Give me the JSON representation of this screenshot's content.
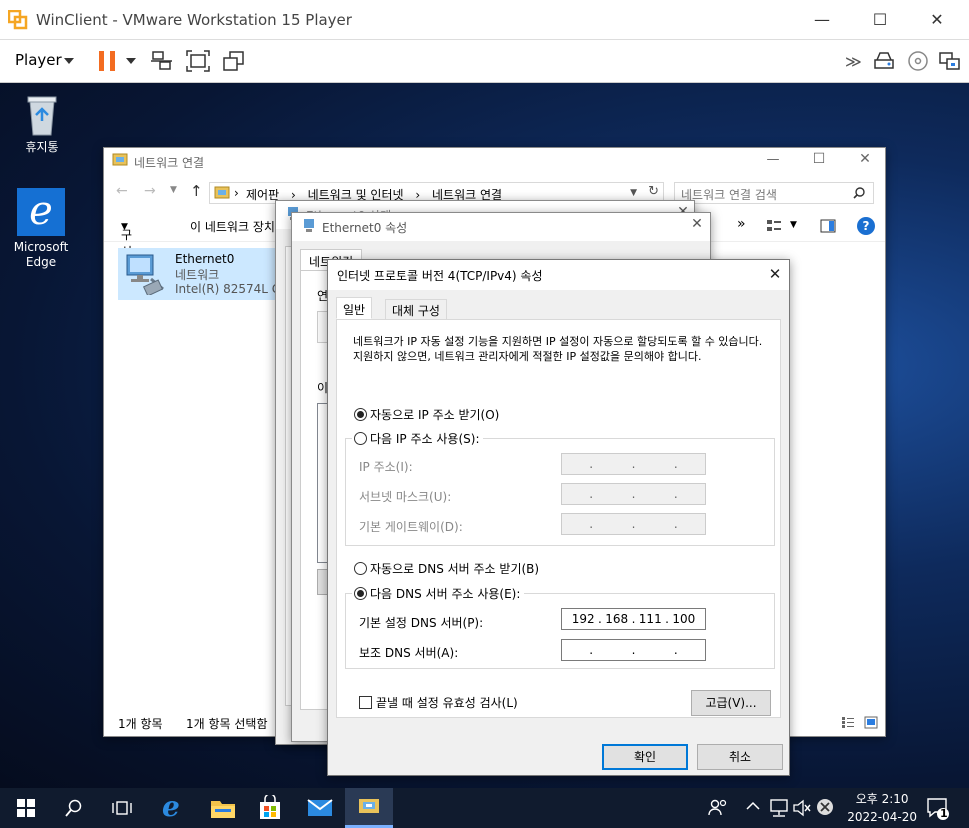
{
  "vm": {
    "title": "WinClient - VMware Workstation 15 Player",
    "player_label": "Player",
    "colors": {
      "pause": "#f36c21",
      "vmware_logo": "#f5a623"
    }
  },
  "desktop": {
    "recycle_bin_label": "휴지통",
    "edge_label_1": "Microsoft",
    "edge_label_2": "Edge"
  },
  "netwin": {
    "title": "네트워크 연결",
    "breadcrumb": {
      "sep": "›",
      "items": [
        "제어판",
        "네트워크 및 인터넷",
        "네트워크 연결"
      ]
    },
    "search_placeholder": "네트워크 연결 검색",
    "cmd": {
      "organize": "구성",
      "disable": "이 네트워크 장치",
      "more": "»"
    },
    "adapter": {
      "name": "Ethernet0",
      "type": "네트워크",
      "device": "Intel(R) 82574L Gig"
    },
    "status": {
      "count": "1개 항목",
      "selected": "1개 항목 선택함"
    }
  },
  "backwin1": {
    "title": "Ethernet0 상태"
  },
  "backwin2": {
    "title": "Ethernet0 속성",
    "tab": "네트워킹",
    "frag1": "연",
    "frag2": "이"
  },
  "dialog": {
    "title": "인터넷 프로토콜 버전 4(TCP/IPv4) 속성",
    "tabs": [
      "일반",
      "대체 구성"
    ],
    "description": "네트워크가 IP 자동 설정 기능을 지원하면 IP 설정이 자동으로 할당되도록 할 수 있습니다. 지원하지 않으면, 네트워크 관리자에게 적절한 IP 설정값을 문의해야 합니다.",
    "auto_ip": "자동으로 IP 주소 받기(O)",
    "manual_ip": "다음 IP 주소 사용(S):",
    "ip_label": "IP 주소(I):",
    "subnet_label": "서브넷 마스크(U):",
    "gateway_label": "기본 게이트웨이(D):",
    "auto_dns": "자동으로 DNS 서버 주소 받기(B)",
    "manual_dns": "다음 DNS 서버 주소 사용(E):",
    "pref_dns_label": "기본 설정 DNS 서버(P):",
    "pref_dns": [
      "192",
      "168",
      "111",
      "100"
    ],
    "alt_dns_label": "보조 DNS 서버(A):",
    "validate": "끝낼 때 설정 유효성 검사(L)",
    "advanced": "고급(V)...",
    "ok": "확인",
    "cancel": "취소",
    "dot": "."
  },
  "taskbar": {
    "time": "오후 2:10",
    "date": "2022-04-20",
    "notif_count": "1"
  }
}
